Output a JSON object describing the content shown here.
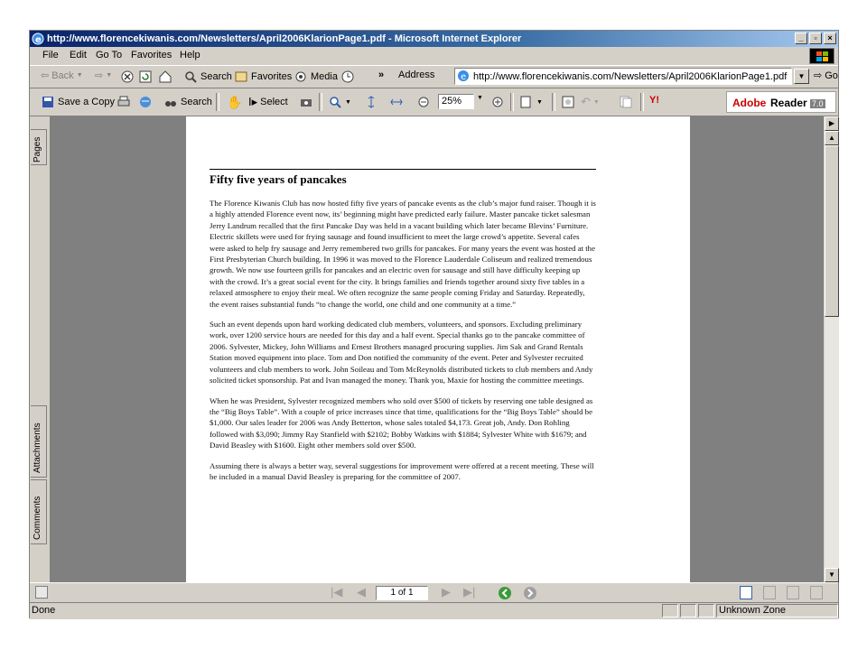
{
  "window": {
    "title": "http://www.florencekiwanis.com/Newsletters/April2006KlarionPage1.pdf - Microsoft Internet Explorer",
    "min_label": "_",
    "max_label": "▫",
    "close_label": "×"
  },
  "menu": [
    "File",
    "Edit",
    "Go To",
    "Favorites",
    "Help"
  ],
  "nav": {
    "back": "Back",
    "search": "Search",
    "favorites": "Favorites",
    "media": "Media",
    "chevron": "»",
    "address_label": "Address",
    "address_value": "http://www.florencekiwanis.com/Newsletters/April2006KlarionPage1.pdf",
    "go": "Go"
  },
  "acrobat": {
    "save_copy": "Save a Copy",
    "search": "Search",
    "select": "Select",
    "zoom": "25%",
    "brand_adobe": "Adobe",
    "brand_reader": "Reader",
    "brand_version": "7.0"
  },
  "sidebar": {
    "pages": "Pages",
    "attachments": "Attachments",
    "comments": "Comments"
  },
  "document": {
    "heading": "Fifty five years of pancakes",
    "paragraphs": [
      "The Florence Kiwanis Club has now hosted fifty five years of pancake events as the club’s major fund raiser.  Though it is a highly attended Florence event now, its’ beginning might have predicted early failure.  Master pancake ticket salesman Jerry Landrum recalled that the first Pancake Day was held in a vacant building which later became Blevins’ Furniture.  Electric skillets were used for frying sausage and found insufficient to meet the large crowd’s appetite.  Several cafes were asked to help fry sausage and Jerry remembered two grills for pancakes.  For many years the event was hosted at the First Presbyterian Church building.  In 1996 it was moved to the Florence Lauderdale Coliseum and realized tremendous growth.  We now use fourteen grills for pancakes and an electric oven for sausage and still have difficulty keeping up with the crowd.  It’s a great social event for the city.  It brings families and friends together around sixty five tables in a relaxed atmosphere to enjoy their meal.  We often recognize the same people coming Friday and Saturday.  Repeatedly, the event raises substantial funds “to change the world, one child and one community at a time.”",
      "Such an event depends upon hard working dedicated club members, volunteers, and sponsors.  Excluding preliminary work, over 1200 service hours are needed for this day and a half event.  Special thanks go to the pancake committee of 2006.  Sylvester, Mickey, John Williams and Ernest Brothers managed procuring supplies.  Jim Sak and Grand Rentals Station moved equipment into place.  Tom and Don notified the community of the event.  Peter and Sylvester recruited volunteers and club members to work.  John Soileau and Tom McReynolds distributed tickets to club members and Andy solicited ticket sponsorship. Pat and Ivan managed the money.  Thank you, Maxie for hosting the committee meetings.",
      "When he was President, Sylvester recognized members who sold over $500 of tickets by reserving one table designed as the “Big Boys Table”.  With a couple of price increases since that time, qualifications for the “Big Boys Table” should be $1,000.  Our sales leader for 2006 was Andy Betterton, whose sales totaled $4,173.  Great job, Andy.  Don Rohling followed with $3,090; Jimmy Ray Stanfield with $2102; Bobby Watkins with $1884; Sylvester White with $1679; and David Beasley with $1600.  Eight other members sold over $500.",
      "Assuming there is always a better way, several suggestions for improvement were offered at a recent meeting.  These will be included in a manual David Beasley is preparing for the committee of 2007."
    ]
  },
  "pager": {
    "page_of": "1 of 1"
  },
  "status": {
    "done": "Done",
    "zone": "Unknown Zone"
  },
  "colors": {
    "title_bar": "#0a246a",
    "chrome": "#d4d0c8",
    "doc_bg": "#808080",
    "adobe_red": "#cc0000"
  }
}
